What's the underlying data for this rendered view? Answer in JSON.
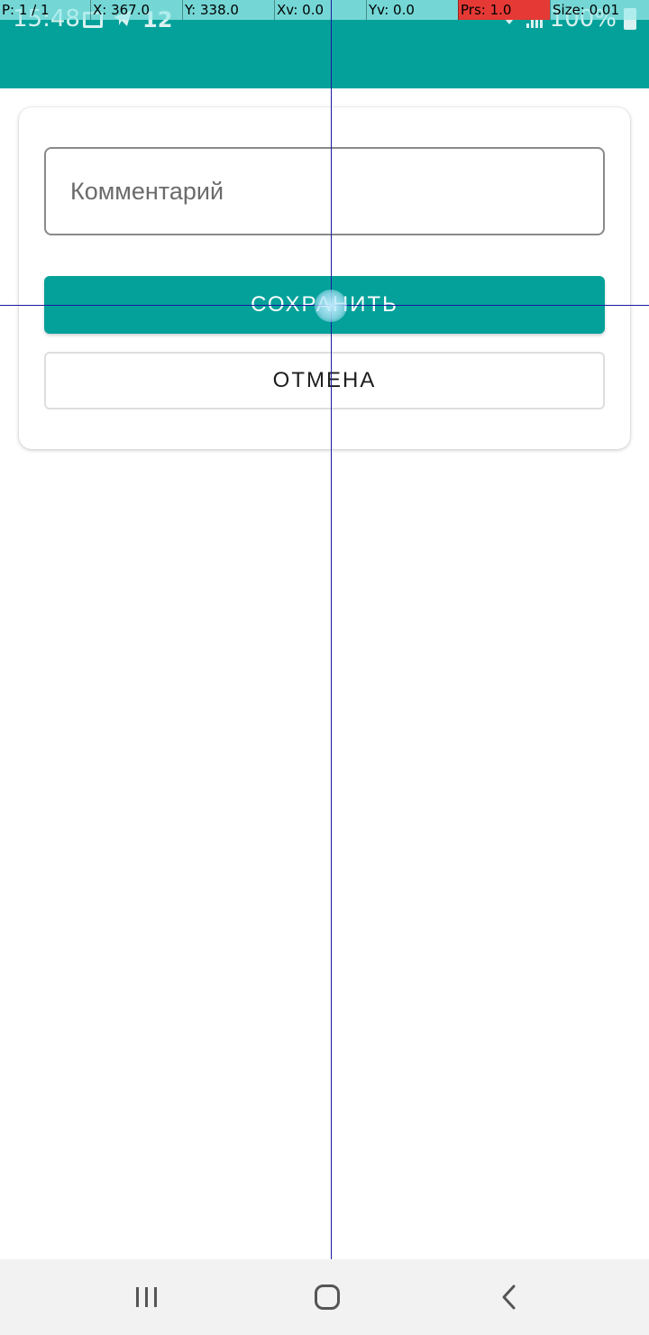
{
  "status_bar": {
    "time": "15:48",
    "notification_count": "12",
    "battery": "100%",
    "icons": [
      "gallery-icon",
      "telegram-icon",
      "wifi-icon",
      "signal-icon",
      "battery-icon"
    ]
  },
  "pointer_overlay": {
    "pointer": "P: 1 / 1",
    "x": "X: 367.0",
    "y": "Y: 338.0",
    "xv": "Xv: 0.0",
    "yv": "Yv: 0.0",
    "prs": "Prs: 1.0",
    "size": "Size: 0.01"
  },
  "form": {
    "comment_placeholder": "Комментарий",
    "comment_value": "",
    "save_label": "СОХРАНИТЬ",
    "cancel_label": "ОТМЕНА"
  },
  "navigation": {
    "icons": [
      "recent-apps-icon",
      "home-icon",
      "back-icon"
    ]
  },
  "colors": {
    "accent": "#04a19a",
    "background": "#ffffff",
    "nav_background": "#f2f2f2",
    "overlay_pressure": "#e53935"
  }
}
